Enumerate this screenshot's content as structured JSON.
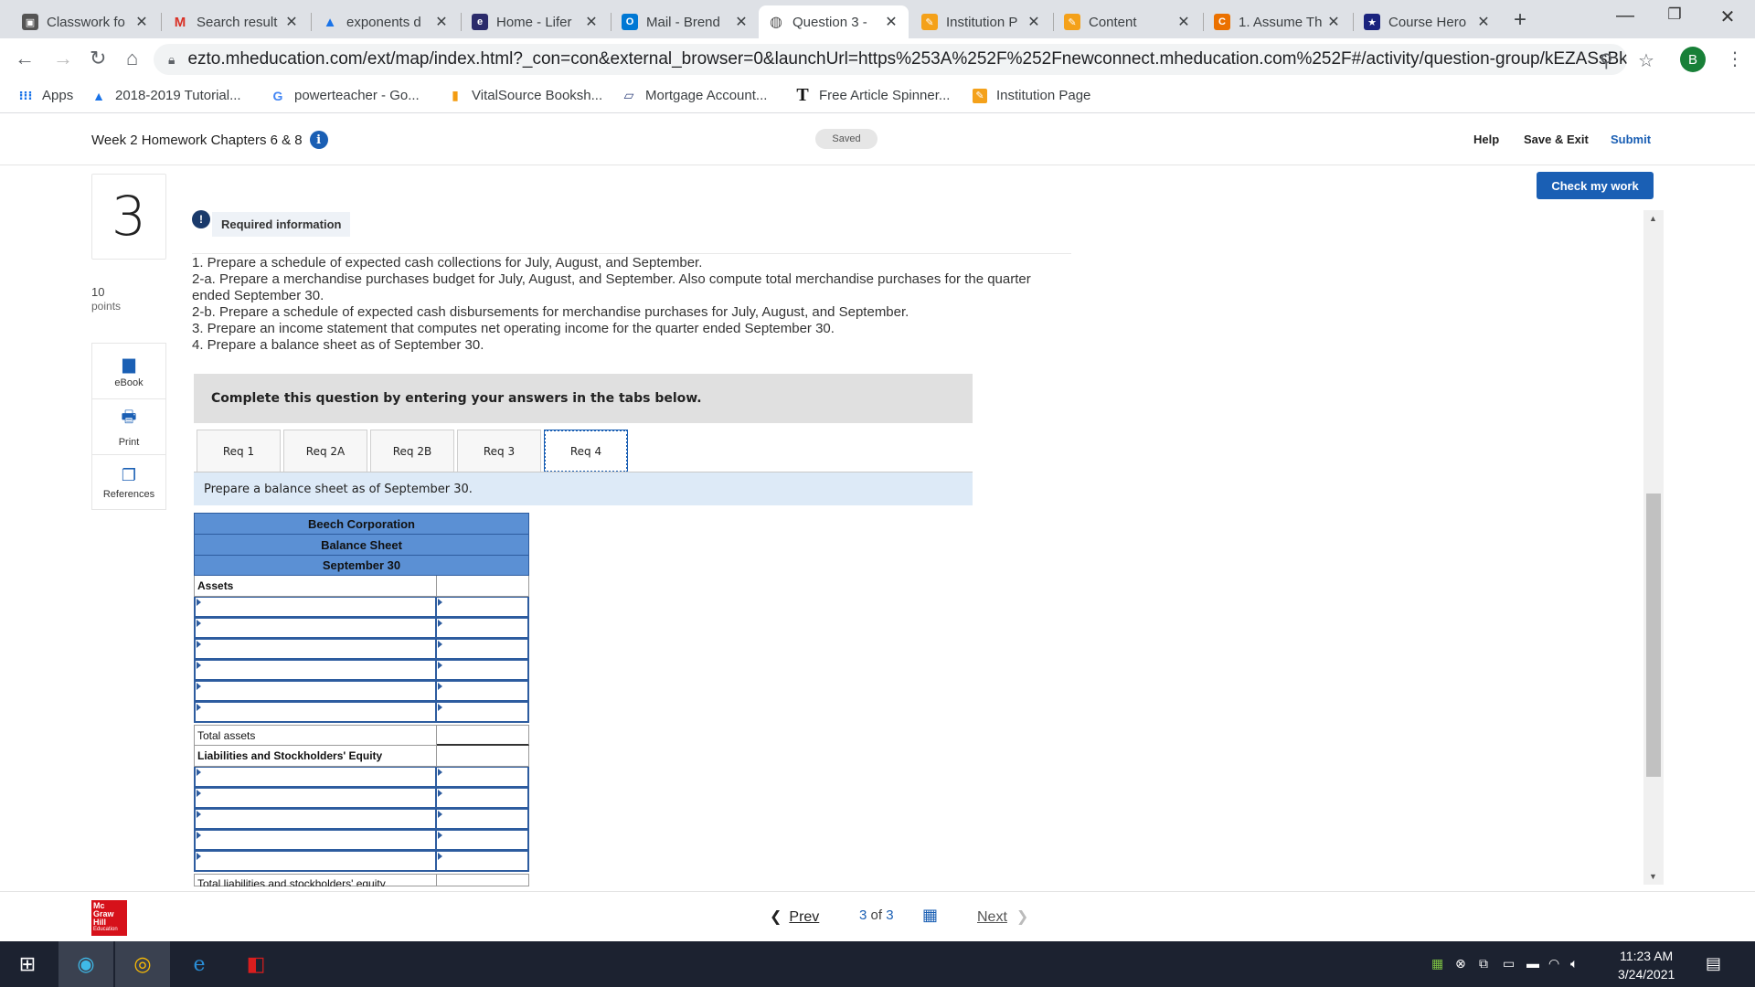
{
  "browser": {
    "tabs": [
      {
        "label": "Classwork fo",
        "icon": "classroom-icon",
        "color": "#444"
      },
      {
        "label": "Search result",
        "icon": "gmail-icon",
        "color": "#d93025"
      },
      {
        "label": "exponents d",
        "icon": "drive-icon",
        "color": "#1a73e8"
      },
      {
        "label": "Home - Lifer",
        "icon": "edge-e-icon",
        "color": "#2b2b6b"
      },
      {
        "label": "Mail - Brend",
        "icon": "outlook-icon",
        "color": "#0078d4"
      },
      {
        "label": "Question 3 -",
        "icon": "globe-icon",
        "color": "#555",
        "active": true
      },
      {
        "label": "Institution P",
        "icon": "pencil-icon",
        "color": "#f4a11a"
      },
      {
        "label": "Content",
        "icon": "pencil-icon",
        "color": "#f4a11a"
      },
      {
        "label": "1. Assume Th",
        "icon": "chegg-icon",
        "color": "#eb7100"
      },
      {
        "label": "Course Hero",
        "icon": "star-icon",
        "color": "#1a237e"
      }
    ],
    "url": "ezto.mheducation.com/ext/map/index.html?_con=con&external_browser=0&launchUrl=https%253A%252F%252Fnewconnect.mheducation.com%252F#/activity/question-group/kEZASsBkEPtVFQ...",
    "profile_initial": "B",
    "bookmarks": [
      {
        "label": "Apps",
        "icon": "apps-grid-icon"
      },
      {
        "label": "2018-2019 Tutorial...",
        "icon": "drive-icon"
      },
      {
        "label": "powerteacher - Go...",
        "icon": "google-icon"
      },
      {
        "label": "VitalSource Booksh...",
        "icon": "vitalsource-icon"
      },
      {
        "label": "Mortgage Account...",
        "icon": "mortgage-icon"
      },
      {
        "label": "Free Article Spinner...",
        "icon": "t-icon"
      },
      {
        "label": "Institution Page",
        "icon": "pencil-icon"
      }
    ]
  },
  "header": {
    "assignment_title": "Week 2 Homework Chapters 6 & 8",
    "saved_label": "Saved",
    "help_label": "Help",
    "save_exit_label": "Save & Exit",
    "submit_label": "Submit"
  },
  "question": {
    "number": "3",
    "points_value": "10",
    "points_label": "points",
    "tools": [
      {
        "label": "eBook",
        "icon": "book-icon"
      },
      {
        "label": "Print",
        "icon": "printer-icon"
      },
      {
        "label": "References",
        "icon": "copy-icon"
      }
    ],
    "check_work_label": "Check my work",
    "required_info_label": "Required information",
    "instructions": [
      "1. Prepare a schedule of expected cash collections for July, August, and September.",
      "2-a. Prepare a merchandise purchases budget for July, August, and September. Also compute total merchandise purchases for the quarter ended September 30.",
      "2-b. Prepare a schedule of expected cash disbursements for merchandise purchases for July, August, and September.",
      "3. Prepare an income statement that computes net operating income for the quarter ended September 30.",
      "4. Prepare a balance sheet as of September 30."
    ],
    "complete_prompt": "Complete this question by entering your answers in the tabs below.",
    "req_tabs": [
      "Req 1",
      "Req 2A",
      "Req 2B",
      "Req 3",
      "Req 4"
    ],
    "active_tab": "Req 4",
    "tab_prompt": "Prepare a balance sheet as of September 30."
  },
  "balance_sheet": {
    "company": "Beech Corporation",
    "statement": "Balance Sheet",
    "date": "September 30",
    "assets_heading": "Assets",
    "asset_rows": [
      "",
      "",
      "",
      "",
      "",
      ""
    ],
    "total_assets_label": "Total assets",
    "liab_heading": "Liabilities and Stockholders' Equity",
    "liab_rows": [
      "",
      "",
      "",
      "",
      ""
    ],
    "total_liab_label": "Total liabilities and stockholders' equity"
  },
  "footer": {
    "logo_lines": [
      "Mc",
      "Graw",
      "Hill",
      "Education"
    ],
    "prev_label": "Prev",
    "page_current": "3",
    "page_of": "of",
    "page_total": "3",
    "next_label": "Next"
  },
  "taskbar": {
    "time": "11:23 AM",
    "date": "3/24/2021"
  },
  "colors": {
    "accent": "#1a5fb4",
    "sheet_header": "#5b90d4",
    "prompt_bg": "#ddeaf7",
    "brand_red": "#d6111a"
  }
}
